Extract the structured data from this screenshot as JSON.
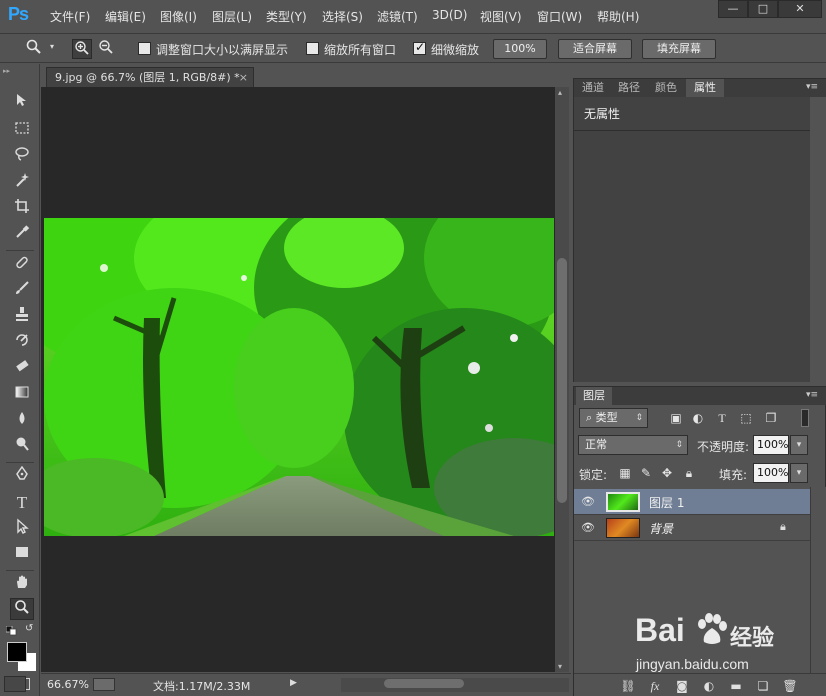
{
  "app": {
    "logo": "Ps"
  },
  "menu": [
    "文件(F)",
    "编辑(E)",
    "图像(I)",
    "图层(L)",
    "类型(Y)",
    "选择(S)",
    "滤镜(T)",
    "3D(D)",
    "视图(V)",
    "窗口(W)",
    "帮助(H)"
  ],
  "window_controls": {
    "minimize": "—",
    "maximize": "□",
    "close": "✕"
  },
  "options": {
    "resize_windows_label": "调整窗口大小以满屏显示",
    "zoom_all_label": "缩放所有窗口",
    "scrubby_label": "细微缩放",
    "btn_100": "100%",
    "btn_fit": "适合屏幕",
    "btn_fill": "填充屏幕"
  },
  "document": {
    "tab_title": "9.jpg @ 66.7% (图层 1, RGB/8#) *",
    "tab_close": "×"
  },
  "status": {
    "zoom": "66.67%",
    "doc_info": "文档:1.17M/2.33M"
  },
  "properties_panel": {
    "tabs": [
      "通道",
      "路径",
      "颜色",
      "属性"
    ],
    "active_tab": "属性",
    "content_title": "无属性"
  },
  "layers_panel": {
    "tab": "图层",
    "filter_kind": "类型",
    "blend_mode": "正常",
    "opacity_label": "不透明度:",
    "opacity_value": "100%",
    "lock_label": "锁定:",
    "fill_label": "填充:",
    "fill_value": "100%",
    "layers": [
      {
        "name": "图层 1",
        "selected": true
      },
      {
        "name": "背景",
        "selected": false
      }
    ],
    "bottom_icons": [
      "link-icon",
      "fx-icon",
      "mask-icon",
      "adjustment-icon",
      "group-icon",
      "new-layer-icon",
      "trash-icon"
    ],
    "fx_label": "fx"
  },
  "watermark": {
    "brand": "Bai",
    "brand2": "经验",
    "url": "jingyan.baidu.com"
  },
  "colors": {
    "accent": "#31a8ff",
    "selected_layer": "#6f7e94",
    "panel": "#535353",
    "canvas_bg": "#282828"
  }
}
